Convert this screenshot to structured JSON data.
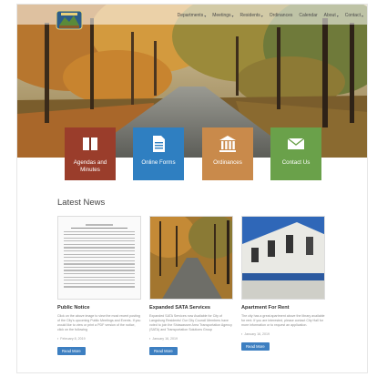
{
  "nav": {
    "items": [
      {
        "label": "Departments",
        "has_dropdown": true
      },
      {
        "label": "Meetings",
        "has_dropdown": true
      },
      {
        "label": "Residents",
        "has_dropdown": true
      },
      {
        "label": "Ordinances",
        "has_dropdown": false
      },
      {
        "label": "Calendar",
        "has_dropdown": false
      },
      {
        "label": "About",
        "has_dropdown": true
      },
      {
        "label": "Contact",
        "has_dropdown": true
      }
    ]
  },
  "tiles": [
    {
      "label": "Agendas and Minutes",
      "color": "#9a3d2b",
      "icon": "book-icon"
    },
    {
      "label": "Online Forms",
      "color": "#2f7fc1",
      "icon": "document-icon"
    },
    {
      "label": "Ordinances",
      "color": "#c98a4b",
      "icon": "building-icon"
    },
    {
      "label": "Contact Us",
      "color": "#6aa14a",
      "icon": "envelope-icon"
    }
  ],
  "news": {
    "heading": "Latest News",
    "items": [
      {
        "title": "Public Notice",
        "desc": "Click on the above image to view the most recent posting of the City's upcoming Public Meetings and Events. If you would like to view or print a PDF version of the notice, click on the following",
        "date": "February 8, 2019",
        "button": "Read More"
      },
      {
        "title": "Expanded SATA Services",
        "desc": "Expanded SATA Services now Available for City of Langsburg Residents! Our City Council Members have voted to join the Shiawassee Area Transportation Agency (SATA) and Transportation Solutions Group",
        "date": "January 16, 2019",
        "button": "Read More"
      },
      {
        "title": "Apartment For Rent",
        "desc": "The city has a great apartment above the library available for rent. If you are interested, please contact City Hall for more information or to request an application.",
        "date": "January 16, 2019",
        "button": "Read More"
      }
    ]
  }
}
